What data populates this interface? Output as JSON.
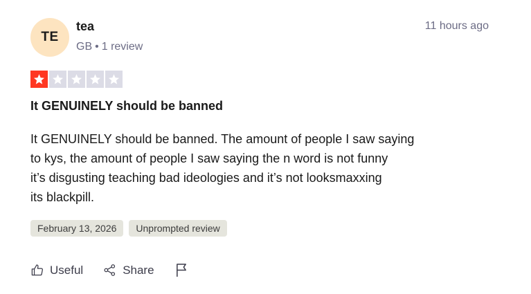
{
  "author": {
    "initials": "TE",
    "name": "tea",
    "country": "GB",
    "separator": "•",
    "review_count": "1 review",
    "avatar_color": "#fde4c0"
  },
  "timestamp": "11 hours ago",
  "rating": {
    "value": 1,
    "max": 5,
    "active_color": "#ff3722",
    "inactive_color": "#dcdce6"
  },
  "review": {
    "title": "It GENUINELY should be banned",
    "body_lines": [
      "It GENUINELY should be banned. The amount of people I saw saying",
      "to kys, the amount of people I saw saying the n word is not funny",
      "it’s disgusting teaching bad ideologies and it’s not looksmaxxing",
      "its blackpill."
    ]
  },
  "tags": {
    "date": "February 13, 2026",
    "type": "Unprompted review"
  },
  "actions": {
    "useful_label": "Useful",
    "share_label": "Share",
    "useful_icon": "thumbs-up-icon",
    "share_icon": "share-icon",
    "flag_icon": "flag-icon"
  }
}
